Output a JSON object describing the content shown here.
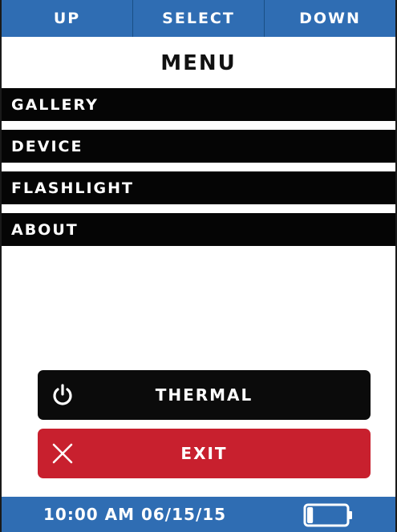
{
  "colors": {
    "accent_blue": "#2f6db3",
    "accent_red": "#c8202e"
  },
  "softkeys": {
    "up": "UP",
    "select": "SELECT",
    "down": "DOWN"
  },
  "menu": {
    "title": "MENU",
    "items": [
      {
        "label": "GALLERY"
      },
      {
        "label": "DEVICE"
      },
      {
        "label": "FLASHLIGHT"
      },
      {
        "label": "ABOUT"
      }
    ]
  },
  "actions": {
    "thermal": {
      "label": "THERMAL",
      "icon": "power-icon"
    },
    "exit": {
      "label": "EXIT",
      "icon": "close-icon"
    }
  },
  "status": {
    "datetime": "10:00 AM 06/15/15",
    "battery_icon": "battery-icon",
    "battery_level": 0.15
  }
}
